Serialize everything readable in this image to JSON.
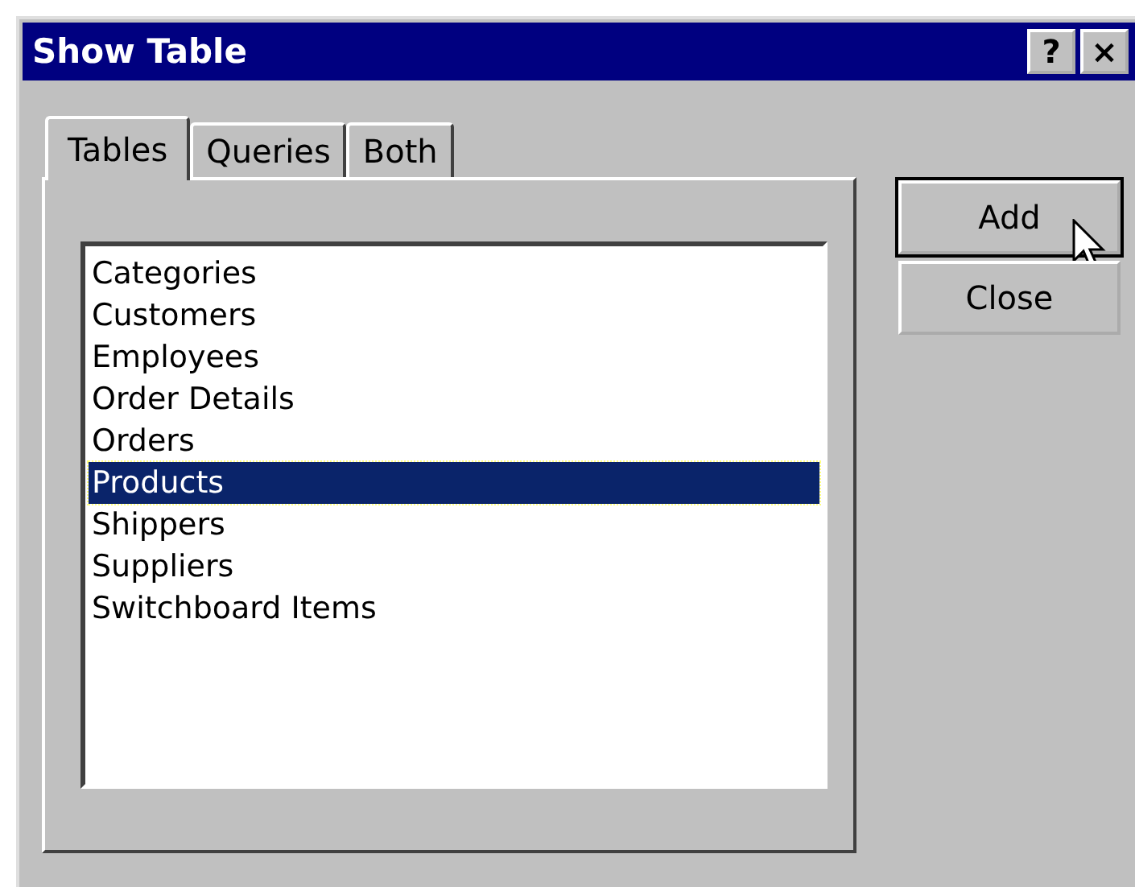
{
  "window": {
    "title": "Show Table",
    "help_button": "?",
    "close_button": "×"
  },
  "tabs": [
    {
      "label": "Tables",
      "selected": true
    },
    {
      "label": "Queries",
      "selected": false
    },
    {
      "label": "Both",
      "selected": false
    }
  ],
  "list": {
    "items": [
      {
        "label": "Categories",
        "selected": false
      },
      {
        "label": "Customers",
        "selected": false
      },
      {
        "label": "Employees",
        "selected": false
      },
      {
        "label": "Order Details",
        "selected": false
      },
      {
        "label": "Orders",
        "selected": false
      },
      {
        "label": "Products",
        "selected": true
      },
      {
        "label": "Shippers",
        "selected": false
      },
      {
        "label": "Suppliers",
        "selected": false
      },
      {
        "label": "Switchboard Items",
        "selected": false
      }
    ]
  },
  "buttons": [
    {
      "label": "Add",
      "default": true
    },
    {
      "label": "Close",
      "default": false
    }
  ]
}
